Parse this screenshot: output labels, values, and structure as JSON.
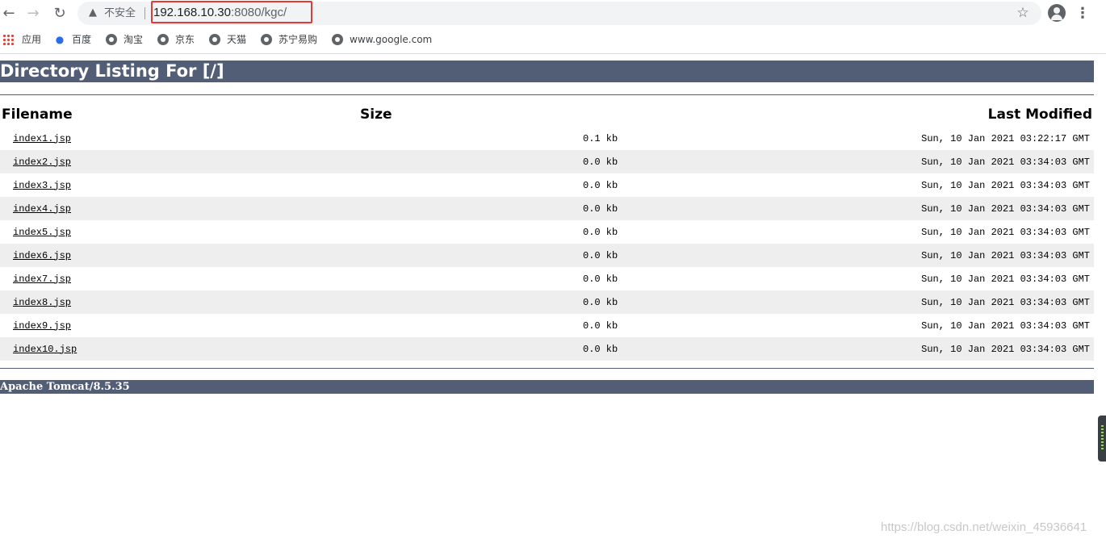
{
  "browser": {
    "security_label": "不安全",
    "url_host": "192.168.10.30",
    "url_rest": ":8080/kgc/",
    "bookmarks": [
      "应用",
      "百度",
      "淘宝",
      "京东",
      "天猫",
      "苏宁易购",
      "www.google.com"
    ]
  },
  "page": {
    "heading": "Directory Listing For [/]",
    "columns": {
      "filename": "Filename",
      "size": "Size",
      "modified": "Last Modified"
    },
    "files": [
      {
        "name": "index1.jsp",
        "size": "0.1 kb",
        "modified": "Sun, 10 Jan 2021 03:22:17 GMT"
      },
      {
        "name": "index2.jsp",
        "size": "0.0 kb",
        "modified": "Sun, 10 Jan 2021 03:34:03 GMT"
      },
      {
        "name": "index3.jsp",
        "size": "0.0 kb",
        "modified": "Sun, 10 Jan 2021 03:34:03 GMT"
      },
      {
        "name": "index4.jsp",
        "size": "0.0 kb",
        "modified": "Sun, 10 Jan 2021 03:34:03 GMT"
      },
      {
        "name": "index5.jsp",
        "size": "0.0 kb",
        "modified": "Sun, 10 Jan 2021 03:34:03 GMT"
      },
      {
        "name": "index6.jsp",
        "size": "0.0 kb",
        "modified": "Sun, 10 Jan 2021 03:34:03 GMT"
      },
      {
        "name": "index7.jsp",
        "size": "0.0 kb",
        "modified": "Sun, 10 Jan 2021 03:34:03 GMT"
      },
      {
        "name": "index8.jsp",
        "size": "0.0 kb",
        "modified": "Sun, 10 Jan 2021 03:34:03 GMT"
      },
      {
        "name": "index9.jsp",
        "size": "0.0 kb",
        "modified": "Sun, 10 Jan 2021 03:34:03 GMT"
      },
      {
        "name": "index10.jsp",
        "size": "0.0 kb",
        "modified": "Sun, 10 Jan 2021 03:34:03 GMT"
      }
    ],
    "footer": "Apache Tomcat/8.5.35"
  },
  "watermark": "https://blog.csdn.net/weixin_45936641",
  "colors": {
    "banner": "#525d76",
    "highlight_box": "#e53935"
  }
}
